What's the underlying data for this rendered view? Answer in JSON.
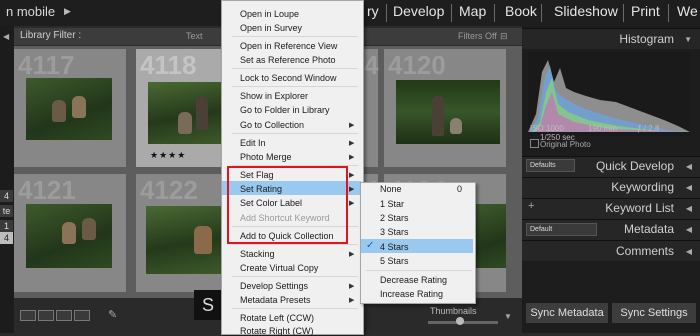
{
  "app": {
    "title": "n mobile"
  },
  "modules": [
    "ry",
    "Develop",
    "Map",
    "Book",
    "Slideshow",
    "Print",
    "We"
  ],
  "left_strip": {
    "tabs": [
      "4",
      "te",
      "1",
      "4"
    ]
  },
  "library": {
    "filter_label": "Library Filter :",
    "text_tab": "Text",
    "filters_off": "Filters Off",
    "cell_numbers": [
      "4117",
      "4118",
      "4",
      "4120",
      "4121",
      "4122",
      "4",
      "4124"
    ],
    "rating_stars": "★★★★",
    "thumbnails_label": "Thumbnails",
    "overlay_letter": "S"
  },
  "right_panel": {
    "histogram": "Histogram",
    "iso": "ISO 1000",
    "focal": "190 mm",
    "aperture": "ƒ / 2,8",
    "shutter": "1/250 sec",
    "original_photo": "Original Photo",
    "defaults": "Defaults",
    "quick_develop": "Quick Develop",
    "keywording": "Keywording",
    "keyword_list": "Keyword List",
    "default": "Default",
    "metadata": "Metadata",
    "comments": "Comments",
    "sync_metadata": "Sync Metadata",
    "sync_settings": "Sync Settings"
  },
  "context_menu": {
    "items": [
      {
        "label": "Open in Loupe"
      },
      {
        "label": "Open in Survey"
      },
      {
        "label": "Open in Reference View"
      },
      {
        "label": "Set as Reference Photo"
      },
      {
        "label": "Lock to Second Window"
      },
      {
        "label": "Show in Explorer"
      },
      {
        "label": "Go to Folder in Library"
      },
      {
        "label": "Go to Collection"
      },
      {
        "label": "Edit In"
      },
      {
        "label": "Photo Merge"
      },
      {
        "label": "Set Flag"
      },
      {
        "label": "Set Rating"
      },
      {
        "label": "Set Color Label"
      },
      {
        "label": "Add Shortcut Keyword"
      },
      {
        "label": "Add to Quick Collection"
      },
      {
        "label": "Stacking"
      },
      {
        "label": "Create Virtual Copy"
      },
      {
        "label": "Develop Settings"
      },
      {
        "label": "Metadata Presets"
      },
      {
        "label": "Rotate Left (CCW)"
      },
      {
        "label": "Rotate Right (CW)"
      }
    ],
    "highlighted": "Set Rating"
  },
  "rating_submenu": {
    "items": [
      "None",
      "1 Star",
      "2 Stars",
      "3 Stars",
      "4 Stars",
      "5 Stars",
      "Decrease Rating",
      "Increase Rating"
    ],
    "none_shortcut": "0",
    "checked": "4 Stars"
  },
  "colors": {
    "highlight": "#99c9ef",
    "annotation": "#e0141e"
  }
}
